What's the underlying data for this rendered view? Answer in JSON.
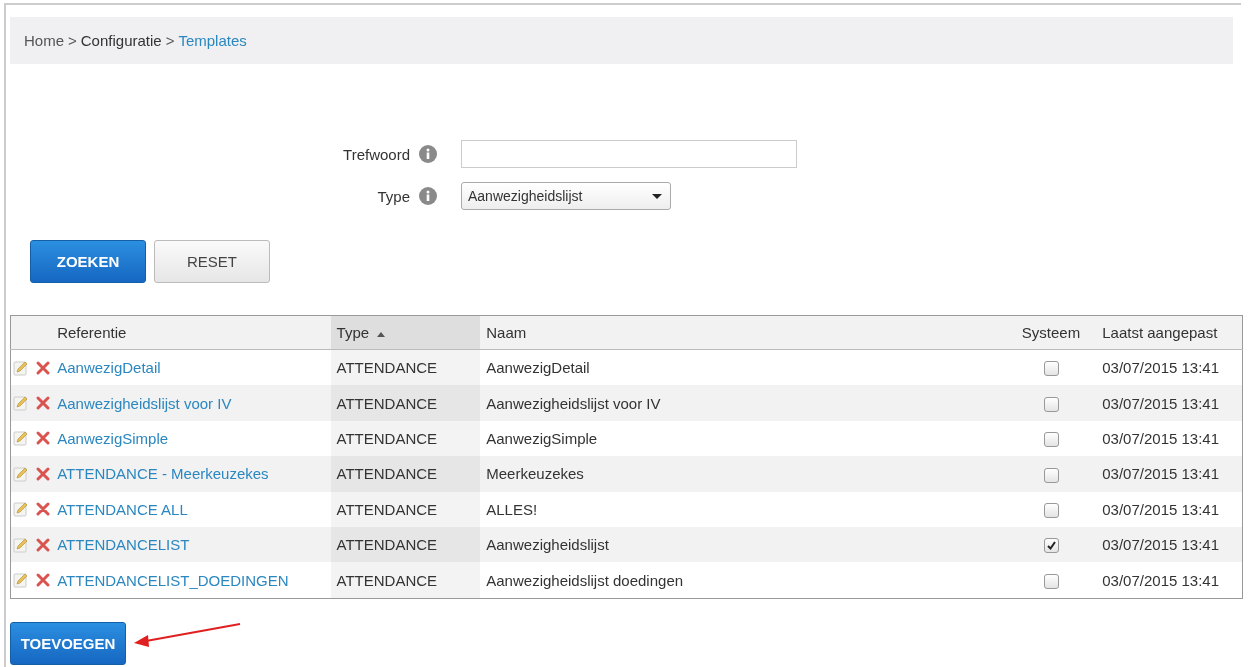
{
  "breadcrumb": [
    {
      "label": "Home",
      "current": false
    },
    {
      "label": "Configuratie",
      "current": false
    },
    {
      "label": "Templates",
      "current": true
    }
  ],
  "breadcrumb_separator": ">",
  "form": {
    "fields": [
      {
        "label": "Trefwoord",
        "kind": "text"
      },
      {
        "label": "Type",
        "kind": "select",
        "value": "Aanwezigheidslijst"
      }
    ]
  },
  "buttons": [
    {
      "label": "ZOEKEN",
      "primary": true
    },
    {
      "label": "RESET",
      "primary": false
    }
  ],
  "table": {
    "columns": [
      {
        "label": "Referentie",
        "sorted": false
      },
      {
        "label": "Type",
        "sorted": true
      },
      {
        "label": "Naam",
        "sorted": false
      },
      {
        "label": "Systeem",
        "sorted": false
      },
      {
        "label": "Laatst aangepast",
        "sorted": false
      }
    ],
    "rows": [
      {
        "referentie": "AanwezigDetail",
        "type": "ATTENDANCE",
        "naam": "AanwezigDetail",
        "systeem": false,
        "datum": "03/07/2015 13:41"
      },
      {
        "referentie": "Aanwezigheidslijst voor IV",
        "type": "ATTENDANCE",
        "naam": "Aanwezigheidslijst voor IV",
        "systeem": false,
        "datum": "03/07/2015 13:41"
      },
      {
        "referentie": "AanwezigSimple",
        "type": "ATTENDANCE",
        "naam": "AanwezigSimple",
        "systeem": false,
        "datum": "03/07/2015 13:41"
      },
      {
        "referentie": "ATTENDANCE - Meerkeuzekes",
        "type": "ATTENDANCE",
        "naam": "Meerkeuzekes",
        "systeem": false,
        "datum": "03/07/2015 13:41"
      },
      {
        "referentie": "ATTENDANCE ALL",
        "type": "ATTENDANCE",
        "naam": "ALLES!",
        "systeem": false,
        "datum": "03/07/2015 13:41"
      },
      {
        "referentie": "ATTENDANCELIST",
        "type": "ATTENDANCE",
        "naam": "Aanwezigheidslijst",
        "systeem": true,
        "datum": "03/07/2015 13:41"
      },
      {
        "referentie": "ATTENDANCELIST_DOEDINGEN",
        "type": "ATTENDANCE",
        "naam": "Aanwezigheidslijst doedingen",
        "systeem": false,
        "datum": "03/07/2015 13:41"
      }
    ]
  },
  "add_button": {
    "label": "TOEVOEGEN"
  }
}
